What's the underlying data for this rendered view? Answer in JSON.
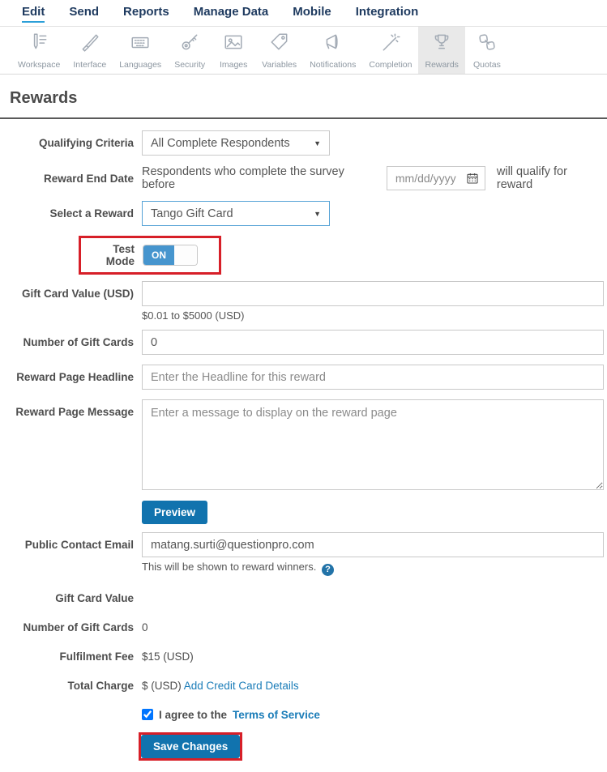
{
  "nav": {
    "items": [
      {
        "label": "Edit",
        "active": true
      },
      {
        "label": "Send",
        "active": false
      },
      {
        "label": "Reports",
        "active": false
      },
      {
        "label": "Manage Data",
        "active": false
      },
      {
        "label": "Mobile",
        "active": false
      },
      {
        "label": "Integration",
        "active": false
      }
    ]
  },
  "toolbar": {
    "items": [
      {
        "label": "Workspace",
        "icon": "workspace-icon",
        "active": false
      },
      {
        "label": "Interface",
        "icon": "interface-icon",
        "active": false
      },
      {
        "label": "Languages",
        "icon": "languages-icon",
        "active": false
      },
      {
        "label": "Security",
        "icon": "security-icon",
        "active": false
      },
      {
        "label": "Images",
        "icon": "images-icon",
        "active": false
      },
      {
        "label": "Variables",
        "icon": "variables-icon",
        "active": false
      },
      {
        "label": "Notifications",
        "icon": "notifications-icon",
        "active": false
      },
      {
        "label": "Completion",
        "icon": "completion-icon",
        "active": false
      },
      {
        "label": "Rewards",
        "icon": "rewards-icon",
        "active": true
      },
      {
        "label": "Quotas",
        "icon": "quotas-icon",
        "active": false
      }
    ]
  },
  "page": {
    "title": "Rewards"
  },
  "form": {
    "qualifying_criteria": {
      "label": "Qualifying Criteria",
      "value": "All Complete Respondents"
    },
    "reward_end_date": {
      "label": "Reward End Date",
      "prefix": "Respondents who complete the survey before",
      "placeholder": "mm/dd/yyyy",
      "suffix": "will qualify for reward"
    },
    "select_reward": {
      "label": "Select a Reward",
      "value": "Tango Gift Card"
    },
    "test_mode": {
      "label": "Test Mode",
      "state": "ON"
    },
    "gift_card_value": {
      "label": "Gift Card Value (USD)",
      "value": "",
      "helper": "$0.01 to $5000 (USD)"
    },
    "num_gift_cards": {
      "label": "Number of Gift Cards",
      "value": "0"
    },
    "headline": {
      "label": "Reward Page Headline",
      "placeholder": "Enter the Headline for this reward"
    },
    "message": {
      "label": "Reward Page Message",
      "placeholder": "Enter a message to display on the reward page"
    },
    "preview_button": "Preview",
    "contact_email": {
      "label": "Public Contact Email",
      "value": "matang.surti@questionpro.com",
      "helper": "This will be shown to reward winners.",
      "help_icon": "?"
    },
    "summary": [
      {
        "label": "Gift Card Value",
        "value": ""
      },
      {
        "label": "Number of Gift Cards",
        "value": "0"
      },
      {
        "label": "Fulfilment Fee",
        "value": "$15 (USD)"
      },
      {
        "label": "Total Charge",
        "value": "$ (USD)",
        "link": "Add Credit Card Details"
      }
    ],
    "terms": {
      "prefix": "I agree to the",
      "link": "Terms of Service",
      "checked": true
    },
    "save_button": "Save Changes"
  },
  "colors": {
    "accent_blue": "#1173ae",
    "toggle_blue": "#4695ce",
    "link_blue": "#1a7cb8",
    "nav_navy": "#1e3a5f",
    "annotation_red": "#d71f28",
    "active_tab_bg": "#e9e9e9"
  }
}
